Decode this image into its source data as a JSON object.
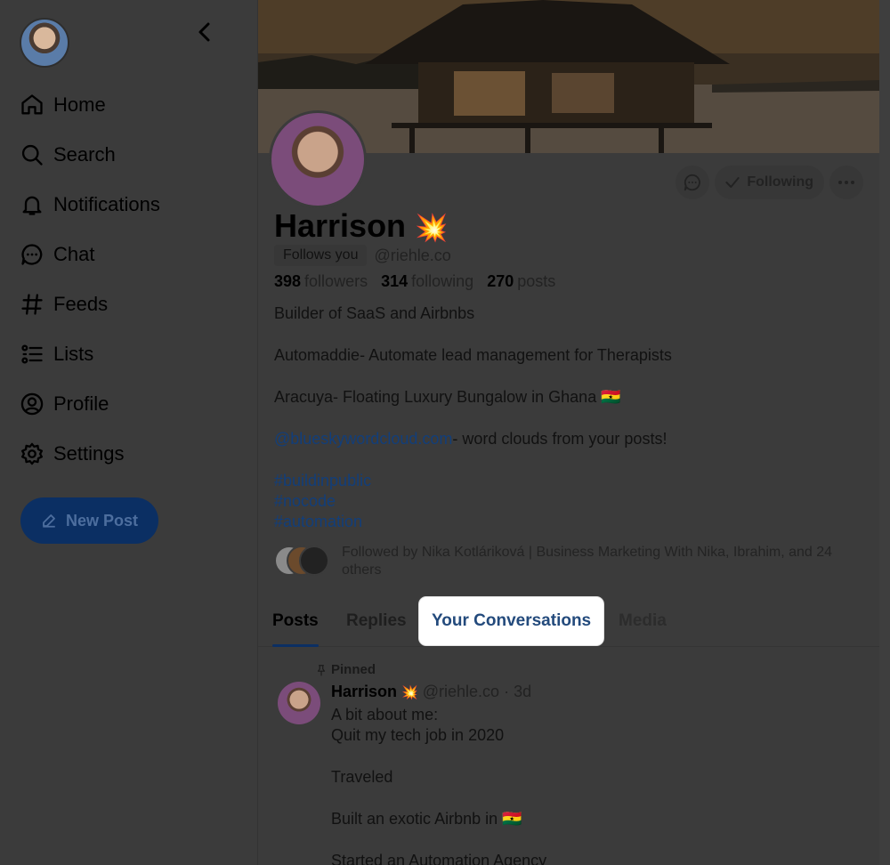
{
  "nav": {
    "items": [
      {
        "label": "Home",
        "icon": "home-icon"
      },
      {
        "label": "Search",
        "icon": "search-icon"
      },
      {
        "label": "Notifications",
        "icon": "bell-icon"
      },
      {
        "label": "Chat",
        "icon": "chat-icon"
      },
      {
        "label": "Feeds",
        "icon": "hash-icon"
      },
      {
        "label": "Lists",
        "icon": "list-icon"
      },
      {
        "label": "Profile",
        "icon": "profile-icon"
      },
      {
        "label": "Settings",
        "icon": "gear-icon"
      }
    ],
    "new_post": "New Post"
  },
  "profile": {
    "name": "Harrison",
    "name_emoji": "💥",
    "follows_you": "Follows you",
    "handle": "@riehle.co",
    "followers_count": "398",
    "followers_label": "followers",
    "following_count": "314",
    "following_label": "following",
    "posts_count": "270",
    "posts_label": "posts",
    "following_button": "Following",
    "bio": {
      "line1": "Builder of SaaS and Airbnbs",
      "line2": "Automaddie- Automate lead management for Therapists",
      "line3": "Aracuya- Floating Luxury Bungalow in Ghana 🇬🇭",
      "link": "@blueskywordcloud.com",
      "link_suffix": "- word clouds from your posts!",
      "tag1": "#buildinpublic",
      "tag2": "#nocode",
      "tag3": "#automation"
    },
    "followed_by": "Followed by Nika Kotláriková | Business Marketing With Nika, Ibrahim, and 24 others"
  },
  "tabs": [
    "Posts",
    "Replies",
    "Your Conversations",
    "Media"
  ],
  "pinned_post": {
    "pinned_label": "Pinned",
    "author": "Harrison",
    "author_emoji": "💥",
    "handle": "@riehle.co",
    "time": "· 3d",
    "line1": "A bit about me:",
    "line2": "Quit my tech job in 2020",
    "line3": "Traveled",
    "line4": "Built an exotic Airbnb in 🇬🇭",
    "line5": "Started an Automation Agency"
  },
  "colors": {
    "accent": "#0b2f63",
    "link": "#123e7a",
    "background_dim": "#3b3b3b"
  }
}
